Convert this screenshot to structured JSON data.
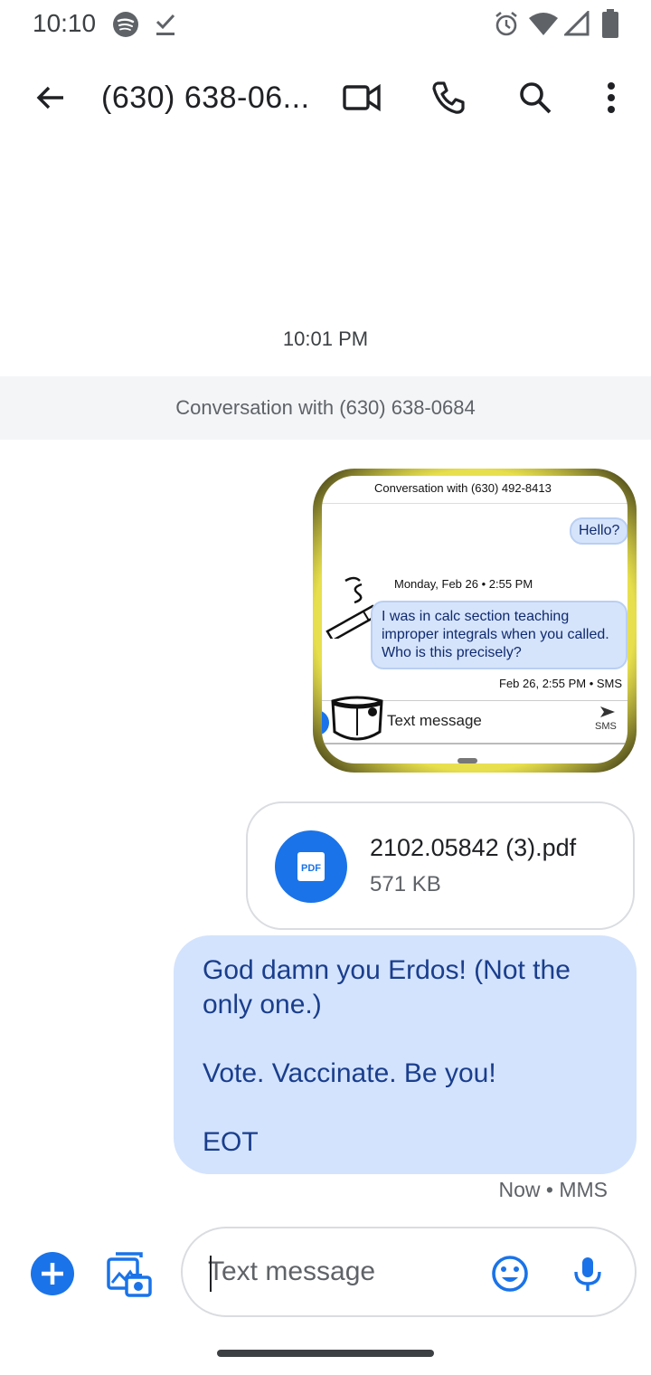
{
  "status_bar": {
    "time": "10:10",
    "left_icons": [
      "spotify-icon",
      "check-download-icon"
    ],
    "right_icons": [
      "alarm-icon",
      "wifi-icon",
      "signal-icon",
      "battery-icon"
    ]
  },
  "app_bar": {
    "title": "(630) 638-06...",
    "actions": [
      "back-arrow-icon",
      "video-call-icon",
      "phone-icon",
      "search-icon",
      "more-vert-icon"
    ]
  },
  "conversation": {
    "timestamp": "10:01 PM",
    "banner": "Conversation with (630) 638-0684"
  },
  "image_message": {
    "header": "Conversation with (630) 492-8413",
    "bubble_hello": "Hello?",
    "date_line": "Monday, Feb 26 • 2:55 PM",
    "bubble_body": "I was in calc section teaching improper integrals when you called. Who is this precisely?",
    "bubble_meta": "Feb 26, 2:55 PM • SMS",
    "compose_placeholder": "Text message",
    "send_label": "SMS"
  },
  "attachment": {
    "icon_label": "PDF",
    "file_name": "2102.05842 (3).pdf",
    "file_size": "571 KB"
  },
  "outgoing_message": {
    "line1": "God damn you Erdos! (Not the only one.)",
    "line2": "Vote. Vaccinate. Be you!",
    "line3": "EOT",
    "meta": "Now • MMS"
  },
  "compose": {
    "placeholder": "Text message"
  },
  "colors": {
    "accent": "#1a73e8",
    "bubble_outgoing": "#d3e3fd",
    "bubble_text": "#1a3e8c"
  }
}
